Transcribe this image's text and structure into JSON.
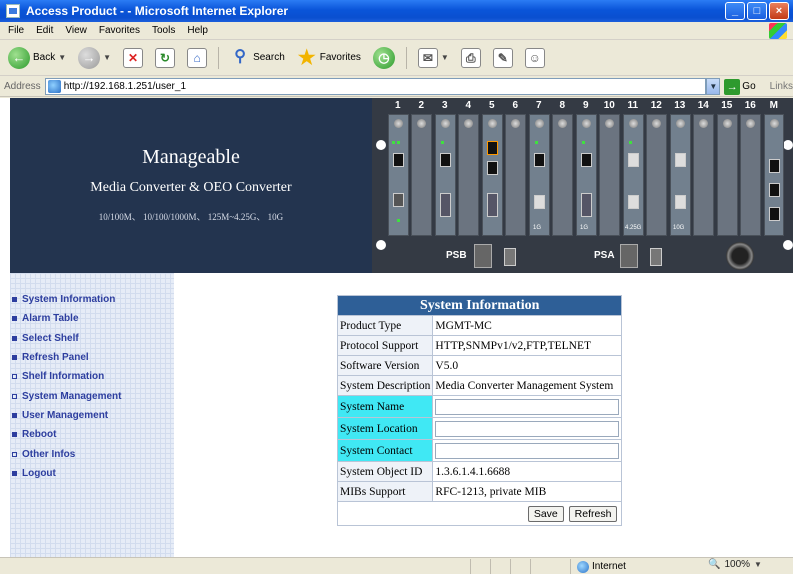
{
  "window": {
    "title": "Access Product - - Microsoft Internet Explorer",
    "minimize_icon": "minimize-icon",
    "maximize_icon": "maximize-icon",
    "close_icon": "close-icon"
  },
  "menu": [
    "File",
    "Edit",
    "View",
    "Favorites",
    "Tools",
    "Help"
  ],
  "toolbar": {
    "back_label": "Back",
    "search_label": "Search",
    "favorites_label": "Favorites"
  },
  "address": {
    "label": "Address",
    "url": "http://192.168.1.251/user_1",
    "go_label": "Go",
    "links_label": "Links"
  },
  "banner": {
    "title": "Manageable",
    "subtitle": "Media Converter & OEO Converter",
    "spec": "10/100M、 10/100/1000M、 125M~4.25G、 10G"
  },
  "chassis": {
    "slot_numbers": [
      "1",
      "2",
      "3",
      "4",
      "5",
      "6",
      "7",
      "8",
      "9",
      "10",
      "11",
      "12",
      "13",
      "14",
      "15",
      "16",
      "M"
    ],
    "slot_tags": [
      "1G",
      "1G",
      "4.25G",
      "10G"
    ],
    "psb_label": "PSB",
    "psa_label": "PSA"
  },
  "sidebar": {
    "items": [
      {
        "label": "System Information",
        "hollow": false
      },
      {
        "label": "Alarm Table",
        "hollow": false
      },
      {
        "label": "Select Shelf",
        "hollow": false
      },
      {
        "label": "Refresh Panel",
        "hollow": false
      },
      {
        "label": "Shelf Information",
        "hollow": true
      },
      {
        "label": "System Management",
        "hollow": true
      },
      {
        "label": "User Management",
        "hollow": false
      },
      {
        "label": "Reboot",
        "hollow": false
      },
      {
        "label": "Other Infos",
        "hollow": true
      },
      {
        "label": "Logout",
        "hollow": false
      }
    ]
  },
  "system_info": {
    "title": "System Information",
    "rows": [
      {
        "label": "Product Type",
        "value": "MGMT-MC"
      },
      {
        "label": "Protocol Support",
        "value": "HTTP,SNMPv1/v2,FTP,TELNET"
      },
      {
        "label": "Software Version",
        "value": "V5.0"
      },
      {
        "label": "System Description",
        "value": "Media Converter Management System"
      }
    ],
    "editable": [
      {
        "label": "System Name",
        "value": ""
      },
      {
        "label": "System Location",
        "value": ""
      },
      {
        "label": "System Contact",
        "value": ""
      }
    ],
    "rows_after": [
      {
        "label": "System Object ID",
        "value": "1.3.6.1.4.1.6688"
      },
      {
        "label": "MIBs Support",
        "value": "RFC-1213, private MIB"
      }
    ],
    "save_label": "Save",
    "refresh_label": "Refresh"
  },
  "status": {
    "zone": "Internet",
    "zoom": "100%"
  }
}
